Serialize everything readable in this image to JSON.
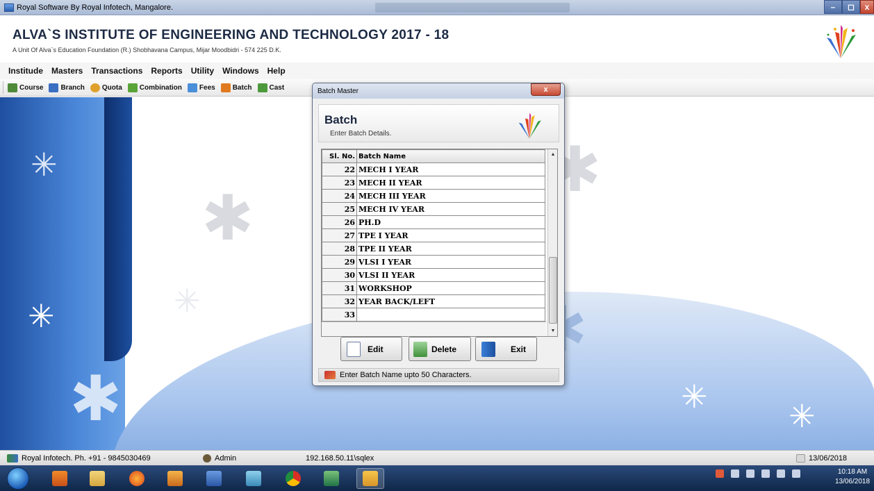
{
  "window": {
    "title": "Royal Software By Royal Infotech, Mangalore."
  },
  "header": {
    "institute_name": "ALVA`S INSTITUTE OF ENGINEERING AND TECHNOLOGY  2017 - 18",
    "subtitle": "A Unit Of Alva`s Education Foundation (R.) Shobhavana Campus, Mijar Moodbidri - 574 225 D.K."
  },
  "menu": [
    "Institude",
    "Masters",
    "Transactions",
    "Reports",
    "Utility",
    "Windows",
    "Help"
  ],
  "toolbar": [
    {
      "label": "Course",
      "icon": "course-icon",
      "color": "#4f8a3a"
    },
    {
      "label": "Branch",
      "icon": "branch-icon",
      "color": "#3b6fc2"
    },
    {
      "label": "Quota",
      "icon": "quota-icon",
      "color": "#e0a12c"
    },
    {
      "label": "Combination",
      "icon": "combination-icon",
      "color": "#5aa53a"
    },
    {
      "label": "Fees",
      "icon": "fees-icon",
      "color": "#4a8fd8"
    },
    {
      "label": "Batch",
      "icon": "batch-icon",
      "color": "#e07a20"
    },
    {
      "label": "Cast",
      "icon": "cast-icon",
      "color": "#4d9a3d"
    }
  ],
  "dialog": {
    "caption": "Batch Master",
    "close_label": "x",
    "heading": "Batch",
    "subheading": "Enter Batch Details.",
    "columns": {
      "sl_no": "Sl. No.",
      "batch_name": "Batch Name"
    },
    "rows": [
      {
        "sl": "22",
        "name": "MECH I YEAR"
      },
      {
        "sl": "23",
        "name": "MECH II YEAR"
      },
      {
        "sl": "24",
        "name": "MECH III YEAR"
      },
      {
        "sl": "25",
        "name": "MECH IV YEAR"
      },
      {
        "sl": "26",
        "name": "PH.D"
      },
      {
        "sl": "27",
        "name": "TPE I YEAR"
      },
      {
        "sl": "28",
        "name": "TPE II YEAR"
      },
      {
        "sl": "29",
        "name": "VLSI I YEAR"
      },
      {
        "sl": "30",
        "name": "VLSI II YEAR"
      },
      {
        "sl": "31",
        "name": "WORKSHOP"
      },
      {
        "sl": "32",
        "name": "YEAR BACK/LEFT"
      },
      {
        "sl": "33",
        "name": ""
      }
    ],
    "buttons": {
      "edit": "Edit",
      "delete": "Delete",
      "exit": "Exit"
    },
    "status": "Enter Batch Name upto 50 Characters."
  },
  "statusbar": {
    "company": "Royal Infotech.  Ph. +91 - 9845030469",
    "user": "Admin",
    "server": "192.168.50.11\\sqlex",
    "date": "13/06/2018"
  },
  "taskbar": {
    "time": "10:18 AM",
    "date": "13/06/2018"
  },
  "colors": {
    "accent_blue": "#1f4fa0",
    "title_bar": "#c4d0e3",
    "close_red": "#c74a33"
  }
}
